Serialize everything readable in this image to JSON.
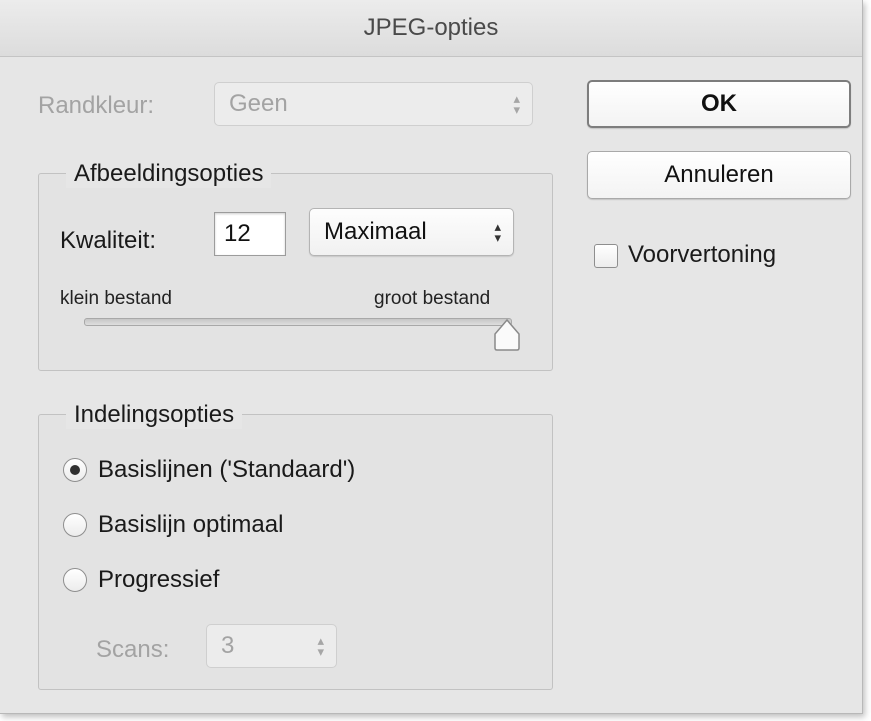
{
  "window": {
    "title": "JPEG-opties"
  },
  "matte": {
    "label": "Randkleur:",
    "value": "Geen"
  },
  "image_options": {
    "legend": "Afbeeldingsopties",
    "quality_label": "Kwaliteit:",
    "quality_value": "12",
    "quality_preset": "Maximaal",
    "slider_min_label": "klein bestand",
    "slider_max_label": "groot bestand",
    "slider_value_fraction": 1.0
  },
  "format_options": {
    "legend": "Indelingsopties",
    "radios": [
      {
        "label": "Basislijnen ('Standaard')",
        "selected": true
      },
      {
        "label": "Basislijn optimaal",
        "selected": false
      },
      {
        "label": "Progressief",
        "selected": false
      }
    ],
    "scans_label": "Scans:",
    "scans_value": "3"
  },
  "buttons": {
    "ok": "OK",
    "cancel": "Annuleren"
  },
  "preview": {
    "label": "Voorvertoning",
    "checked": false
  },
  "icons": {
    "stepper": "up-down-arrows-icon",
    "slider_thumb": "slider-thumb-icon"
  }
}
